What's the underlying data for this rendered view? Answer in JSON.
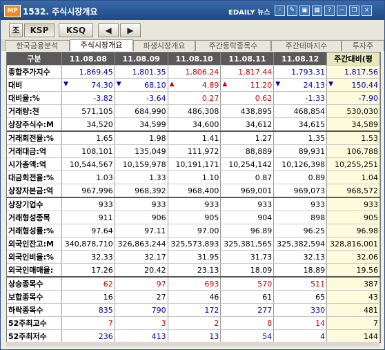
{
  "window": {
    "code": "MP",
    "title": "1532. 주식시장개요",
    "brand": "EDAILY 뉴스"
  },
  "titlebar_icons": [
    "lightning-icon",
    "pencil-icon",
    "picture-icon",
    "grid-icon",
    "help-icon",
    "minimize-icon",
    "restore-icon",
    "close-icon"
  ],
  "toolbar": {
    "jo": "조",
    "ksp": "KSP",
    "ksq": "KSQ",
    "prev": "◀",
    "next": "▶"
  },
  "tabs": [
    "한국금융분석",
    "주식시장개요",
    "파생시장개요",
    "주간등락종목수",
    "주간테마지수",
    "투자주"
  ],
  "selected_tab": 1,
  "table": {
    "headers": [
      "구분",
      "11.08.08",
      "11.08.09",
      "11.08.10",
      "11.08.11",
      "11.08.12",
      "주간대비(평"
    ],
    "rows": [
      {
        "label": "종합주가지수",
        "cells": [
          "1,869.45",
          "1,801.35",
          "1,806.24",
          "1,817.44",
          "1,793.31",
          "1,817.56"
        ],
        "colors": [
          "dn",
          "dn",
          "up",
          "up",
          "dn",
          "dn"
        ]
      },
      {
        "label": "대비",
        "cells": [
          "74.30",
          "68.10",
          "4.89",
          "11.20",
          "24.13",
          "150.44"
        ],
        "arrows": [
          "down",
          "down",
          "up",
          "up",
          "down",
          "down"
        ],
        "colors": [
          "dn",
          "dn",
          "up",
          "up",
          "dn",
          "dn"
        ]
      },
      {
        "label": "대비율:%",
        "cells": [
          "-3.82",
          "-3.64",
          "0.27",
          "0.62",
          "-1.33",
          "-7.90"
        ],
        "colors": [
          "dn",
          "dn",
          "up",
          "up",
          "dn",
          "dn"
        ]
      },
      {
        "label": "거래량:천",
        "cells": [
          "571,105",
          "684,990",
          "486,308",
          "438,895",
          "468,854",
          "530,030"
        ]
      },
      {
        "label": "상장주식수:M",
        "cells": [
          "34,520",
          "34,599",
          "34,600",
          "34,612",
          "34,615",
          "34,589"
        ]
      },
      {
        "label": "거래회전율:%",
        "cells": [
          "1.65",
          "1.98",
          "1.41",
          "1.27",
          "1.35",
          "1.53"
        ],
        "section": true
      },
      {
        "label": "거래대금:억",
        "cells": [
          "108,101",
          "135,049",
          "111,972",
          "88,889",
          "89,931",
          "106,788"
        ]
      },
      {
        "label": "시가총액:억",
        "cells": [
          "10,544,567",
          "10,159,978",
          "10,191,171",
          "10,254,142",
          "10,126,398",
          "10,255,251"
        ]
      },
      {
        "label": "대금회전율:%",
        "cells": [
          "1.03",
          "1.33",
          "1.10",
          "0.87",
          "0.89",
          "1.04"
        ]
      },
      {
        "label": "상장자본금:억",
        "cells": [
          "967,996",
          "968,392",
          "968,400",
          "969,001",
          "969,073",
          "968,572"
        ]
      },
      {
        "label": "상장기업수",
        "cells": [
          "933",
          "933",
          "933",
          "933",
          "933",
          "933"
        ],
        "section": true
      },
      {
        "label": "거래형성종목",
        "cells": [
          "911",
          "906",
          "905",
          "904",
          "898",
          "905"
        ]
      },
      {
        "label": "거래형성률:%",
        "cells": [
          "97.64",
          "97.11",
          "97.00",
          "96.89",
          "96.25",
          "96.98"
        ]
      },
      {
        "label": "외국인잔고:M",
        "cells": [
          "340,878,710",
          "326,863,244",
          "325,573,893",
          "325,381,565",
          "325,382,594",
          "328,816,001"
        ]
      },
      {
        "label": "외국인비율:%",
        "cells": [
          "32.33",
          "32.17",
          "31.95",
          "31.73",
          "32.13",
          "32.06"
        ]
      },
      {
        "label": "외국인매매율:",
        "cells": [
          "17.26",
          "20.42",
          "23.13",
          "18.09",
          "18.89",
          "19.56"
        ]
      },
      {
        "label": "상승종목수",
        "cells": [
          "62",
          "97",
          "693",
          "570",
          "511",
          "387"
        ],
        "colors": [
          "up",
          "up",
          "up",
          "up",
          "up",
          "blk"
        ],
        "section": true
      },
      {
        "label": "보합종목수",
        "cells": [
          "16",
          "27",
          "46",
          "61",
          "65",
          "43"
        ]
      },
      {
        "label": "하락종목수",
        "cells": [
          "835",
          "790",
          "172",
          "277",
          "330",
          "481"
        ],
        "colors": [
          "dn",
          "dn",
          "dn",
          "dn",
          "dn",
          "blk"
        ]
      },
      {
        "label": "52주최고수",
        "cells": [
          "7",
          "3",
          "2",
          "8",
          "14",
          "7"
        ],
        "colors": [
          "up",
          "up",
          "up",
          "up",
          "up",
          "blk"
        ]
      },
      {
        "label": "52주최저수",
        "cells": [
          "236",
          "413",
          "13",
          "54",
          "4",
          "144"
        ],
        "colors": [
          "dn",
          "dn",
          "dn",
          "dn",
          "dn",
          "blk"
        ]
      }
    ]
  }
}
